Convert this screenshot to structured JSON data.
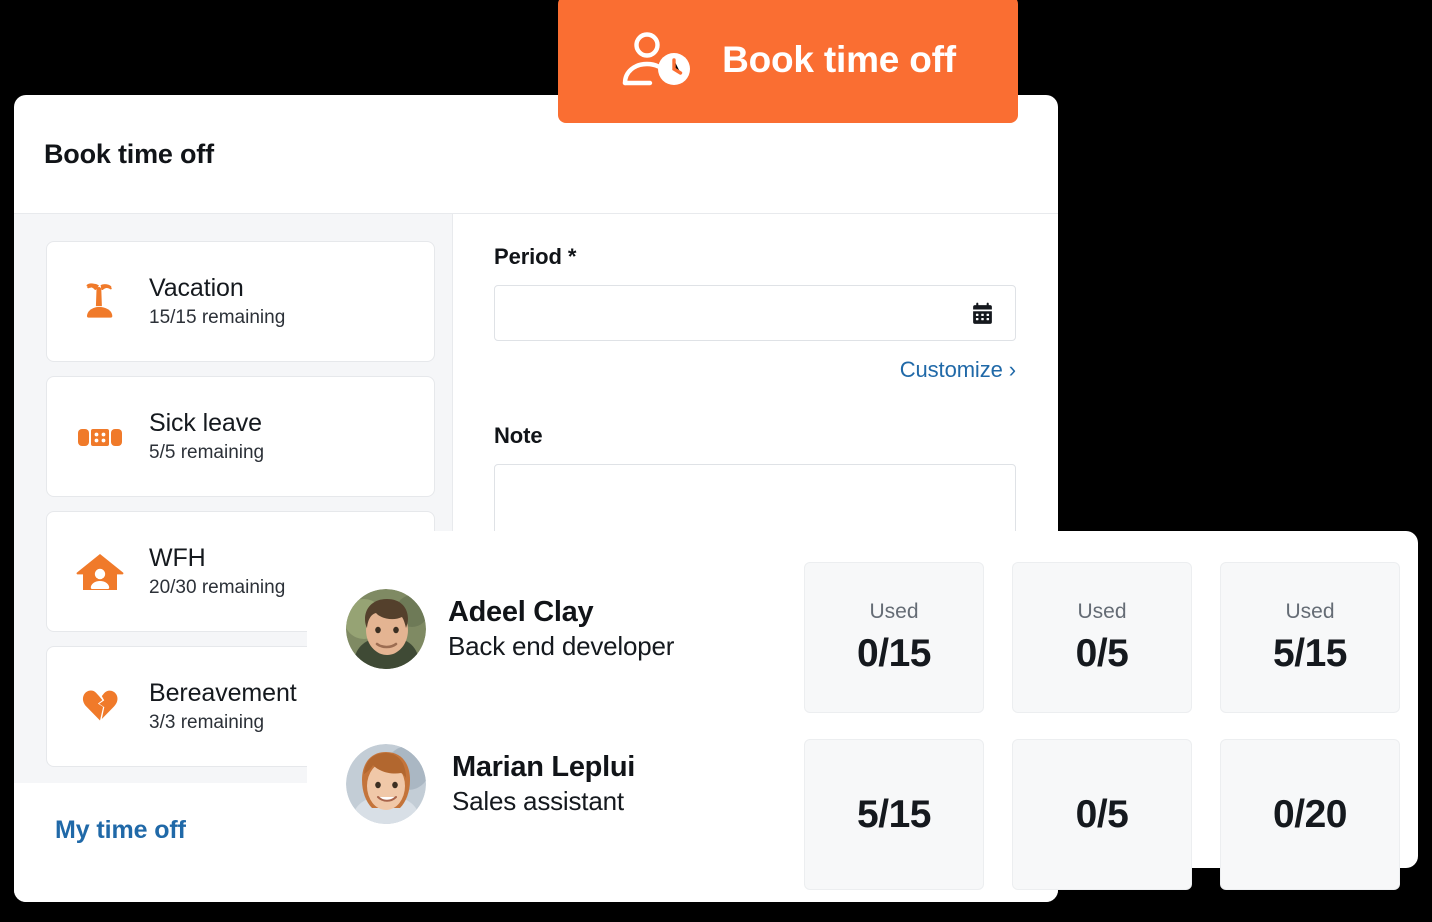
{
  "cta": {
    "label": "Book time off",
    "icon": "person-clock-icon",
    "color": "#fa6e32"
  },
  "modal": {
    "title": "Book time off",
    "leave_types": [
      {
        "icon": "palm-tree-icon",
        "name": "Vacation",
        "remaining": "15/15 remaining"
      },
      {
        "icon": "bandage-icon",
        "name": "Sick leave",
        "remaining": "5/5 remaining"
      },
      {
        "icon": "home-user-icon",
        "name": "WFH",
        "remaining": "20/30 remaining"
      },
      {
        "icon": "broken-heart-icon",
        "name": "Bereavement",
        "remaining": "3/3 remaining"
      }
    ],
    "footer_link": "My time off",
    "form": {
      "period_label": "Period *",
      "period_value": "",
      "period_placeholder": "",
      "period_icon": "calendar-icon",
      "customize_link": "Customize ›",
      "note_label": "Note",
      "note_value": "",
      "note_placeholder": ""
    }
  },
  "people_panel": {
    "people": [
      {
        "name": "Adeel Clay",
        "role": "Back end developer",
        "avatar": "avatar-adeel-clay"
      },
      {
        "name": "Marian Leplui",
        "role": "Sales assistant",
        "avatar": "avatar-marian-leplui"
      }
    ],
    "balances": [
      {
        "caption": "Used",
        "value": "0/15"
      },
      {
        "caption": "Used",
        "value": "0/5"
      },
      {
        "caption": "Used",
        "value": "5/15"
      },
      {
        "caption": "",
        "value": "5/15"
      },
      {
        "caption": "",
        "value": "0/5"
      },
      {
        "caption": "",
        "value": "0/20"
      }
    ]
  },
  "colors": {
    "accent_orange": "#fa6e32",
    "link_blue": "#2069a8",
    "panel_gray": "#f5f6f8",
    "tile_gray": "#f7f8f9"
  }
}
